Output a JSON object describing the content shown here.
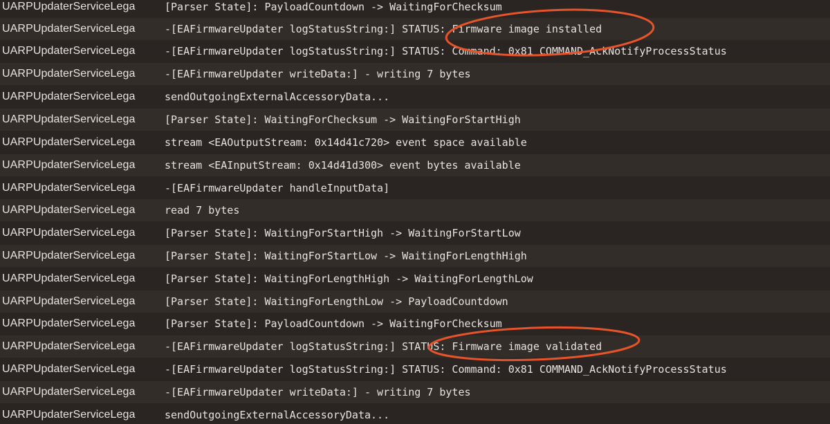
{
  "colors": {
    "background": "#2a2523",
    "row_alt": "#332d2a",
    "text": "#e7e3e0",
    "highlight_ellipse": "#e8542a"
  },
  "log_rows": [
    {
      "process": "UARPUpdaterServiceLega",
      "message": "[Parser State]: PayloadCountdown -> WaitingForChecksum"
    },
    {
      "process": "UARPUpdaterServiceLega",
      "message": "-[EAFirmwareUpdater logStatusString:] STATUS: Firmware image installed"
    },
    {
      "process": "UARPUpdaterServiceLega",
      "message": "-[EAFirmwareUpdater logStatusString:] STATUS: Command: 0x81 COMMAND_AckNotifyProcessStatus"
    },
    {
      "process": "UARPUpdaterServiceLega",
      "message": "-[EAFirmwareUpdater writeData:] - writing 7 bytes"
    },
    {
      "process": "UARPUpdaterServiceLega",
      "message": "sendOutgoingExternalAccessoryData..."
    },
    {
      "process": "UARPUpdaterServiceLega",
      "message": "[Parser State]: WaitingForChecksum -> WaitingForStartHigh"
    },
    {
      "process": "UARPUpdaterServiceLega",
      "message": "stream <EAOutputStream: 0x14d41c720> event space available"
    },
    {
      "process": "UARPUpdaterServiceLega",
      "message": "stream <EAInputStream: 0x14d41d300> event bytes available"
    },
    {
      "process": "UARPUpdaterServiceLega",
      "message": "-[EAFirmwareUpdater handleInputData]"
    },
    {
      "process": "UARPUpdaterServiceLega",
      "message": "read 7 bytes"
    },
    {
      "process": "UARPUpdaterServiceLega",
      "message": "[Parser State]: WaitingForStartHigh -> WaitingForStartLow"
    },
    {
      "process": "UARPUpdaterServiceLega",
      "message": "[Parser State]: WaitingForStartLow -> WaitingForLengthHigh"
    },
    {
      "process": "UARPUpdaterServiceLega",
      "message": "[Parser State]: WaitingForLengthHigh -> WaitingForLengthLow"
    },
    {
      "process": "UARPUpdaterServiceLega",
      "message": "[Parser State]: WaitingForLengthLow -> PayloadCountdown"
    },
    {
      "process": "UARPUpdaterServiceLega",
      "message": "[Parser State]: PayloadCountdown -> WaitingForChecksum"
    },
    {
      "process": "UARPUpdaterServiceLega",
      "message": "-[EAFirmwareUpdater logStatusString:] STATUS: Firmware image validated"
    },
    {
      "process": "UARPUpdaterServiceLega",
      "message": "-[EAFirmwareUpdater logStatusString:] STATUS: Command: 0x81 COMMAND_AckNotifyProcessStatus"
    },
    {
      "process": "UARPUpdaterServiceLega",
      "message": "-[EAFirmwareUpdater writeData:] - writing 7 bytes"
    },
    {
      "process": "UARPUpdaterServiceLega",
      "message": "sendOutgoingExternalAccessoryData..."
    }
  ]
}
